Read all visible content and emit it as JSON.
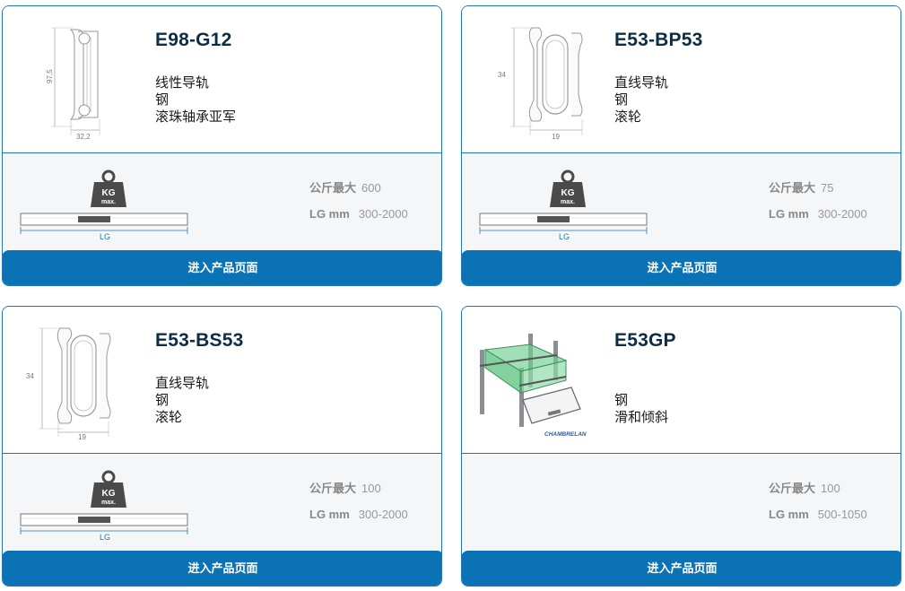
{
  "products": [
    {
      "title": "E98-G12",
      "features": [
        "线性导轨",
        "钢",
        "滚珠轴承亚军"
      ],
      "profile_dims": {
        "height": "97,5",
        "width": "32,2"
      },
      "load_label": "公斤最大",
      "load_value": "600",
      "lg_label": "LG mm",
      "lg_value": "300-2000",
      "diagram_lg": "LG",
      "kg_badge": {
        "top": "KG",
        "bottom": "max."
      },
      "cta": "进入产品页面"
    },
    {
      "title": "E53-BP53",
      "features": [
        "直线导轨",
        "钢",
        "滚轮"
      ],
      "profile_dims": {
        "height": "34",
        "width": "19"
      },
      "load_label": "公斤最大",
      "load_value": "75",
      "lg_label": "LG mm",
      "lg_value": "300-2000",
      "diagram_lg": "LG",
      "kg_badge": {
        "top": "KG",
        "bottom": "max."
      },
      "cta": "进入产品页面"
    },
    {
      "title": "E53-BS53",
      "features": [
        "直线导轨",
        "钢",
        "滚轮"
      ],
      "profile_dims": {
        "height": "34",
        "width": "19"
      },
      "load_label": "公斤最大",
      "load_value": "100",
      "lg_label": "LG mm",
      "lg_value": "300-2000",
      "diagram_lg": "LG",
      "kg_badge": {
        "top": "KG",
        "bottom": "max."
      },
      "cta": "进入产品页面"
    },
    {
      "title": "E53GP",
      "features": [
        "钢",
        "滑和倾斜"
      ],
      "brand_logo": "CHAMBRELAN",
      "load_label": "公斤最大",
      "load_value": "100",
      "lg_label": "LG mm",
      "lg_value": "500-1050",
      "cta": "进入产品页面"
    }
  ],
  "colors": {
    "border": "#1f78b4",
    "cta_bg": "#0b72b5",
    "title": "#0d2d45",
    "panel_bg": "#f5f6f8",
    "spec_grey": "#888888"
  }
}
